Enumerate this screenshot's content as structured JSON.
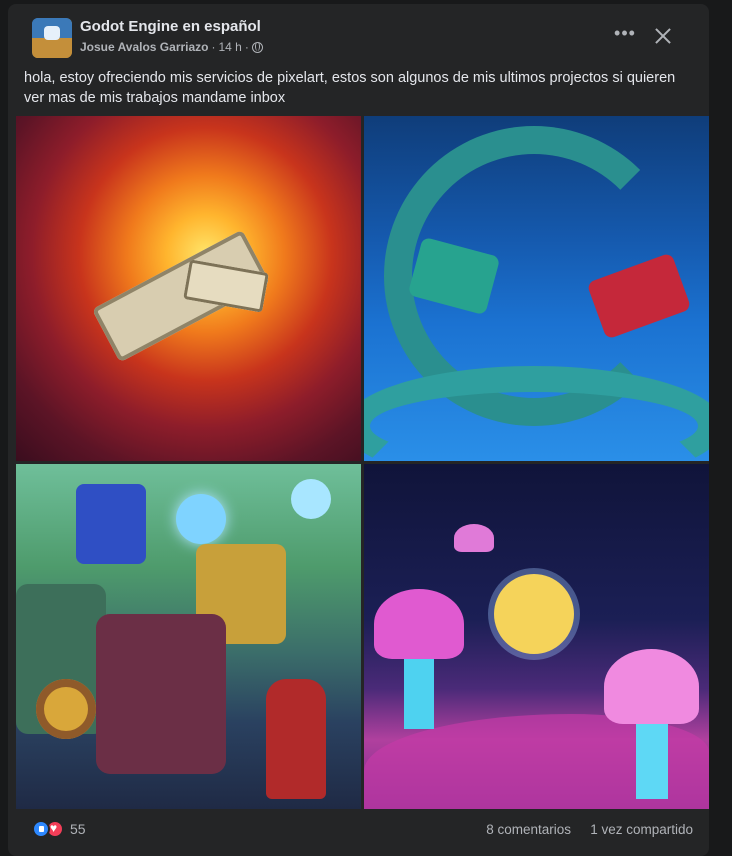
{
  "post": {
    "group_name": "Godot Engine en español",
    "author": "Josue Avalos Garriazo",
    "separator": "·",
    "time": "14 h",
    "privacy_icon": "globe-icon",
    "more_icon": "more-options-icon",
    "close_icon": "close-icon",
    "more_symbol": "•••",
    "text": "hola, estoy ofreciendo mis servicios de pixelart, estos son algunos de mis ultimos projectos si quieren ver mas de mis trabajos mandame inbox"
  },
  "gallery": {
    "images": [
      {
        "name": "fire-skeleton-dragon-artwork"
      },
      {
        "name": "sea-serpents-artwork"
      },
      {
        "name": "robots-mechs-artwork"
      },
      {
        "name": "space-mushrooms-fairy-artwork"
      }
    ]
  },
  "footer": {
    "reaction_icons": [
      "like-icon",
      "love-icon"
    ],
    "reaction_count": "55",
    "comments": "8 comentarios",
    "shares": "1 vez compartido"
  },
  "colors": {
    "background": "#18191a",
    "card": "#242526",
    "text_primary": "#e4e6eb",
    "text_secondary": "#b0b3b8",
    "like_blue": "#2d88ff",
    "love_red": "#f33e58"
  }
}
